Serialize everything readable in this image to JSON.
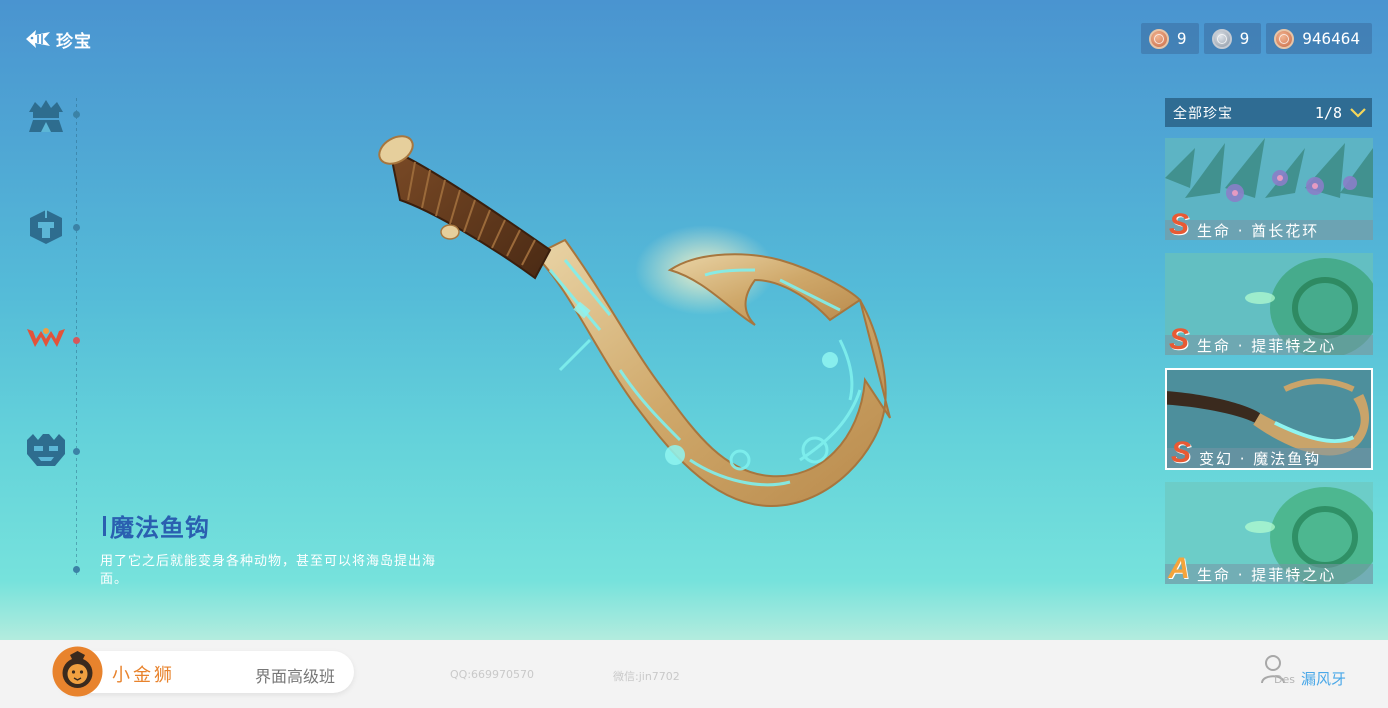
{
  "header": {
    "title": "珍宝",
    "currencies": [
      {
        "icon": "bronze-coin-icon",
        "value": "9"
      },
      {
        "icon": "silver-coin-icon",
        "value": "9"
      },
      {
        "icon": "bronze-coin-icon",
        "value": "946464"
      }
    ]
  },
  "left_nav": {
    "items": [
      {
        "icon": "tent-icon"
      },
      {
        "icon": "helmet-icon"
      },
      {
        "icon": "crown-w-icon",
        "active": true
      },
      {
        "icon": "totem-mask-icon"
      }
    ]
  },
  "item": {
    "name": "魔法鱼钩",
    "description": "用了它之后就能变身各种动物，甚至可以将海岛提出海面。"
  },
  "filter": {
    "label": "全部珍宝",
    "count": "1/8"
  },
  "cards": [
    {
      "rank": "S",
      "name": "生命 · 酋长花环",
      "thumb": "flower-wreath",
      "selected": false
    },
    {
      "rank": "S",
      "name": "生命 · 提菲特之心",
      "thumb": "green-stone",
      "selected": false
    },
    {
      "rank": "S",
      "name": "变幻 · 魔法鱼钩",
      "thumb": "fish-hook",
      "selected": true
    },
    {
      "rank": "A",
      "name": "生命 · 提菲特之心",
      "thumb": "green-stone",
      "selected": false
    }
  ],
  "footer": {
    "brand_name": "小金狮",
    "course": "界面高级班",
    "qq": "QQ:669970570",
    "wechat": "微信:jin7702",
    "author_tag": "Des",
    "author_name": "漏风牙"
  },
  "colors": {
    "accent_blue": "#2a5fb0",
    "rank_s": "#e85a34",
    "rank_a": "#f5a43b",
    "brand_orange": "#e8832d",
    "author_blue": "#4aa8e8"
  }
}
